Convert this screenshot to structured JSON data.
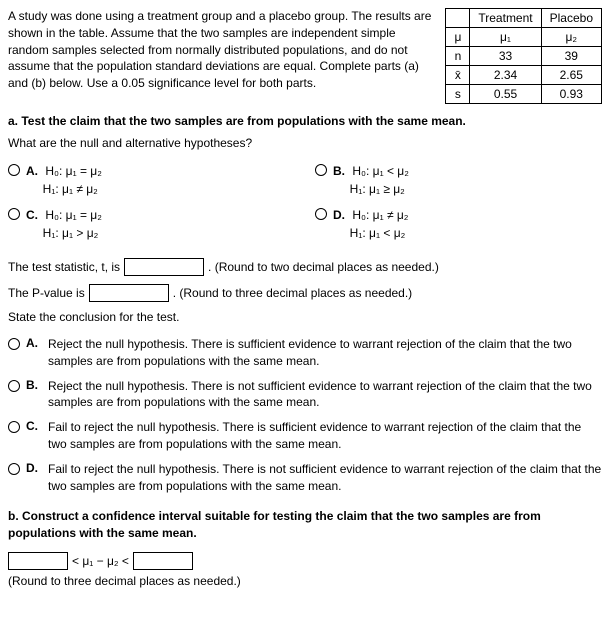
{
  "problem": {
    "text": "A study was done using a treatment group and a placebo group. The results are shown in the table. Assume that the two samples are independent simple random samples selected from normally distributed populations, and do not assume that the population standard deviations are equal. Complete parts (a) and (b) below. Use a 0.05 significance level for both parts."
  },
  "table": {
    "headers": [
      "",
      "Treatment",
      "Placebo"
    ],
    "rows": [
      [
        "μ",
        "μ₁",
        "μ₂"
      ],
      [
        "n",
        "33",
        "39"
      ],
      [
        "x̄",
        "2.34",
        "2.65"
      ],
      [
        "s",
        "0.55",
        "0.93"
      ]
    ]
  },
  "partA": {
    "label": "a. Test the claim that the two samples are from populations with the same mean.",
    "question": "What are the null and alternative hypotheses?",
    "options": {
      "A": {
        "h0": "H₀: μ₁ = μ₂",
        "h1": "H₁: μ₁ ≠ μ₂"
      },
      "B": {
        "h0": "H₀: μ₁ < μ₂",
        "h1": "H₁: μ₁ ≥ μ₂"
      },
      "C": {
        "h0": "H₀: μ₁ = μ₂",
        "h1": "H₁: μ₁ > μ₂"
      },
      "D": {
        "h0": "H₀: μ₁ ≠ μ₂",
        "h1": "H₁: μ₁ < μ₂"
      }
    },
    "testStat": {
      "label": "The test statistic, t, is",
      "hint": ". (Round to two decimal places as needed.)"
    },
    "pValue": {
      "label": "The P-value is",
      "hint": ". (Round to three decimal places as needed.)"
    },
    "conclusionLabel": "State the conclusion for the test.",
    "conclusions": {
      "A": "Reject the null hypothesis. There is sufficient evidence to warrant rejection of the claim that the two samples are from populations with the same mean.",
      "B": "Reject the null hypothesis. There is not sufficient evidence to warrant rejection of the claim that the two samples are from populations with the same mean.",
      "C": "Fail to reject the null hypothesis. There is sufficient evidence to warrant rejection of the claim that the two samples are from populations with the same mean.",
      "D": "Fail to reject the null hypothesis. There is not sufficient evidence to warrant rejection of the claim that the two samples are from populations with the same mean."
    }
  },
  "partB": {
    "label": "b. Construct a confidence interval suitable for testing the claim that the two samples are from populations with the same mean.",
    "ciMid": "< μ₁ − μ₂ <",
    "hint": "(Round to three decimal places as needed.)"
  },
  "labels": {
    "A": "A.",
    "B": "B.",
    "C": "C.",
    "D": "D."
  }
}
